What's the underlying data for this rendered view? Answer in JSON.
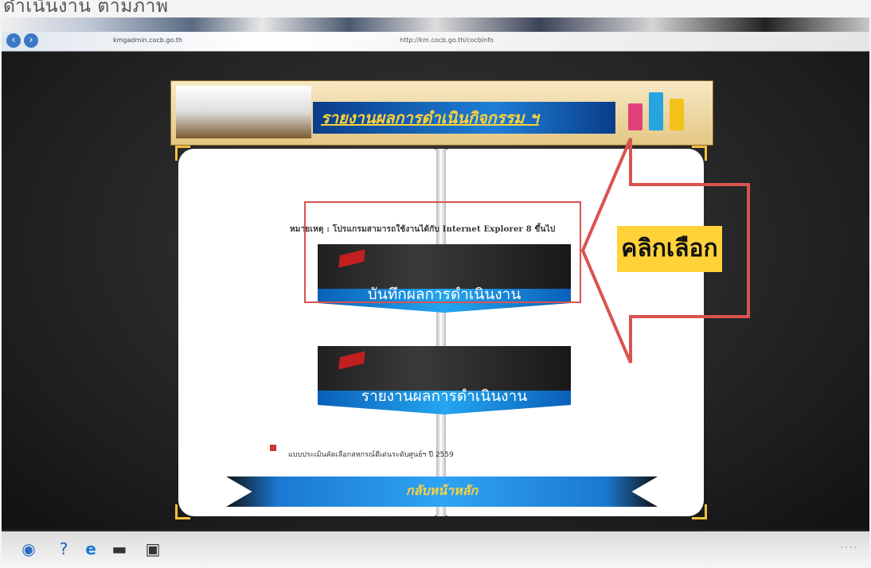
{
  "caption": "ดำเนินงาน ตามภาพ",
  "browser": {
    "url": "kmgadmin.cocb.go.th",
    "tab_title": "http://km.cocb.go.th/cocbinfo"
  },
  "banner": {
    "title": "รายงานผลการดำเนินกิจกรรม ฯ"
  },
  "page": {
    "notice": "หมายเหตุ : โปรแกรมสามารถใช้งานได้กับ Internet Explorer 8 ขึ้นไป",
    "buttons": [
      {
        "label": "บันทึกผลการดำเนินงาน"
      },
      {
        "label": "รายงานผลการดำเนินงาน"
      }
    ],
    "footer_item": "แบบประเมินคัดเลือกสหกรณ์ดีเด่นระดับศูนย์ฯ ปี 2559",
    "back_label": "กลับหน้าหลัก"
  },
  "annotation": {
    "callout": "คลิกเลือก",
    "color": "#d9534f"
  },
  "taskbar": {
    "icons": [
      "start-orb-icon",
      "help-icon",
      "ie-icon",
      "folder-icon",
      "media-icon"
    ]
  }
}
